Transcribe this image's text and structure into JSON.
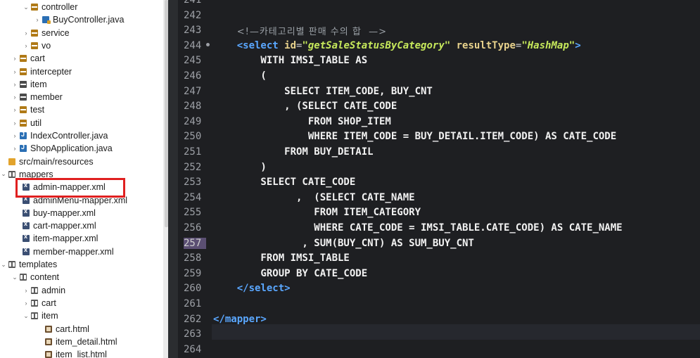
{
  "explorer": {
    "items": [
      {
        "label": "controller",
        "icon": "package-decorated-icon",
        "arrow": "⌄",
        "indent": 32
      },
      {
        "label": "BuyController.java",
        "icon": "java-file-decorated-icon",
        "arrow": "›",
        "indent": 48
      },
      {
        "label": "service",
        "icon": "package-decorated-icon",
        "arrow": "›",
        "indent": 32
      },
      {
        "label": "vo",
        "icon": "package-decorated-icon",
        "arrow": "›",
        "indent": 32
      },
      {
        "label": "cart",
        "icon": "package-decorated-icon",
        "arrow": "›",
        "indent": 16
      },
      {
        "label": "intercepter",
        "icon": "package-decorated-icon",
        "arrow": "›",
        "indent": 16
      },
      {
        "label": "item",
        "icon": "package-icon",
        "arrow": "›",
        "indent": 16
      },
      {
        "label": "member",
        "icon": "package-icon",
        "arrow": "›",
        "indent": 16
      },
      {
        "label": "test",
        "icon": "package-decorated-icon",
        "arrow": "›",
        "indent": 16
      },
      {
        "label": "util",
        "icon": "package-decorated-icon",
        "arrow": "›",
        "indent": 16
      },
      {
        "label": "IndexController.java",
        "icon": "java-file-icon",
        "arrow": "›",
        "indent": 16
      },
      {
        "label": "ShopApplication.java",
        "icon": "java-file-icon",
        "arrow": "›",
        "indent": 16
      },
      {
        "label": "src/main/resources",
        "icon": "source-folder-icon",
        "arrow": "",
        "indent": 0
      },
      {
        "label": "mappers",
        "icon": "folder-icon",
        "arrow": "⌄",
        "indent": 0
      },
      {
        "label": "admin-mapper.xml",
        "icon": "xml-file-icon",
        "arrow": "",
        "indent": 20
      },
      {
        "label": "adminMenu-mapper.xml",
        "icon": "xml-file-icon",
        "arrow": "",
        "indent": 20
      },
      {
        "label": "buy-mapper.xml",
        "icon": "xml-file-icon",
        "arrow": "",
        "indent": 20
      },
      {
        "label": "cart-mapper.xml",
        "icon": "xml-file-icon",
        "arrow": "",
        "indent": 20
      },
      {
        "label": "item-mapper.xml",
        "icon": "xml-file-icon",
        "arrow": "",
        "indent": 20
      },
      {
        "label": "member-mapper.xml",
        "icon": "xml-file-icon",
        "arrow": "",
        "indent": 20
      },
      {
        "label": "templates",
        "icon": "folder-icon",
        "arrow": "⌄",
        "indent": 0
      },
      {
        "label": "content",
        "icon": "folder-icon",
        "arrow": "⌄",
        "indent": 16
      },
      {
        "label": "admin",
        "icon": "folder-icon",
        "arrow": "›",
        "indent": 32
      },
      {
        "label": "cart",
        "icon": "folder-icon",
        "arrow": "›",
        "indent": 32
      },
      {
        "label": "item",
        "icon": "folder-icon",
        "arrow": "⌄",
        "indent": 32
      },
      {
        "label": "cart.html",
        "icon": "html-file-icon",
        "arrow": "",
        "indent": 52
      },
      {
        "label": "item_detail.html",
        "icon": "html-file-icon",
        "arrow": "",
        "indent": 52
      },
      {
        "label": "item_list.html",
        "icon": "html-file-icon",
        "arrow": "",
        "indent": 52
      }
    ],
    "highlighted": "admin-mapper.xml"
  },
  "editor": {
    "current_line": "257",
    "lines": [
      {
        "num": "241",
        "tokens": []
      },
      {
        "num": "242",
        "tokens": []
      },
      {
        "num": "243",
        "tokens": [
          {
            "t": "    ",
            "c": "c-sql"
          },
          {
            "t": "<!—카테고리별 판매 수의 합  —>",
            "c": "c-comment"
          }
        ]
      },
      {
        "num": "244",
        "fold": true,
        "tokens": [
          {
            "t": "    ",
            "c": "c-sql"
          },
          {
            "t": "<select ",
            "c": "c-tag"
          },
          {
            "t": "id",
            "c": "c-attr"
          },
          {
            "t": "=",
            "c": "c-punct"
          },
          {
            "t": "\"getSaleStatusByCategory\"",
            "c": "c-val"
          },
          {
            "t": " resultType",
            "c": "c-attr"
          },
          {
            "t": "=",
            "c": "c-punct"
          },
          {
            "t": "\"HashMap\"",
            "c": "c-val"
          },
          {
            "t": ">",
            "c": "c-tag"
          }
        ]
      },
      {
        "num": "245",
        "tokens": [
          {
            "t": "        WITH IMSI_TABLE AS",
            "c": "c-sql"
          }
        ]
      },
      {
        "num": "246",
        "tokens": [
          {
            "t": "        (",
            "c": "c-sql"
          }
        ]
      },
      {
        "num": "247",
        "tokens": [
          {
            "t": "            SELECT ITEM_CODE, BUY_CNT",
            "c": "c-sql"
          }
        ]
      },
      {
        "num": "248",
        "tokens": [
          {
            "t": "            , (SELECT CATE_CODE",
            "c": "c-sql"
          }
        ]
      },
      {
        "num": "249",
        "tokens": [
          {
            "t": "                FROM SHOP_ITEM",
            "c": "c-sql"
          }
        ]
      },
      {
        "num": "250",
        "tokens": [
          {
            "t": "                WHERE ITEM_CODE = BUY_DETAIL.ITEM_CODE) AS CATE_CODE",
            "c": "c-sql"
          }
        ]
      },
      {
        "num": "251",
        "tokens": [
          {
            "t": "            FROM BUY_DETAIL",
            "c": "c-sql"
          }
        ]
      },
      {
        "num": "252",
        "tokens": [
          {
            "t": "        )",
            "c": "c-sql"
          }
        ]
      },
      {
        "num": "253",
        "tokens": [
          {
            "t": "        SELECT CATE_CODE",
            "c": "c-sql"
          }
        ]
      },
      {
        "num": "254",
        "tokens": [
          {
            "t": "              ,  (SELECT CATE_NAME",
            "c": "c-sql"
          }
        ]
      },
      {
        "num": "255",
        "tokens": [
          {
            "t": "                 FROM ITEM_CATEGORY",
            "c": "c-sql"
          }
        ]
      },
      {
        "num": "256",
        "tokens": [
          {
            "t": "                 WHERE CATE_CODE = IMSI_TABLE.CATE_CODE) AS CATE_NAME",
            "c": "c-sql"
          }
        ]
      },
      {
        "num": "257",
        "tokens": [
          {
            "t": "               , SUM(BUY_CNT) AS SUM_BUY_CNT",
            "c": "c-sql"
          }
        ]
      },
      {
        "num": "258",
        "tokens": [
          {
            "t": "        FROM IMSI_TABLE",
            "c": "c-sql"
          }
        ]
      },
      {
        "num": "259",
        "tokens": [
          {
            "t": "        GROUP BY CATE_CODE",
            "c": "c-sql"
          }
        ]
      },
      {
        "num": "260",
        "tokens": [
          {
            "t": "    ",
            "c": "c-sql"
          },
          {
            "t": "</select>",
            "c": "c-tag"
          }
        ]
      },
      {
        "num": "261",
        "tokens": []
      },
      {
        "num": "262",
        "tokens": [
          {
            "t": "</mapper>",
            "c": "c-tag"
          }
        ]
      },
      {
        "num": "263",
        "tokens": []
      },
      {
        "num": "264",
        "tokens": []
      }
    ]
  }
}
